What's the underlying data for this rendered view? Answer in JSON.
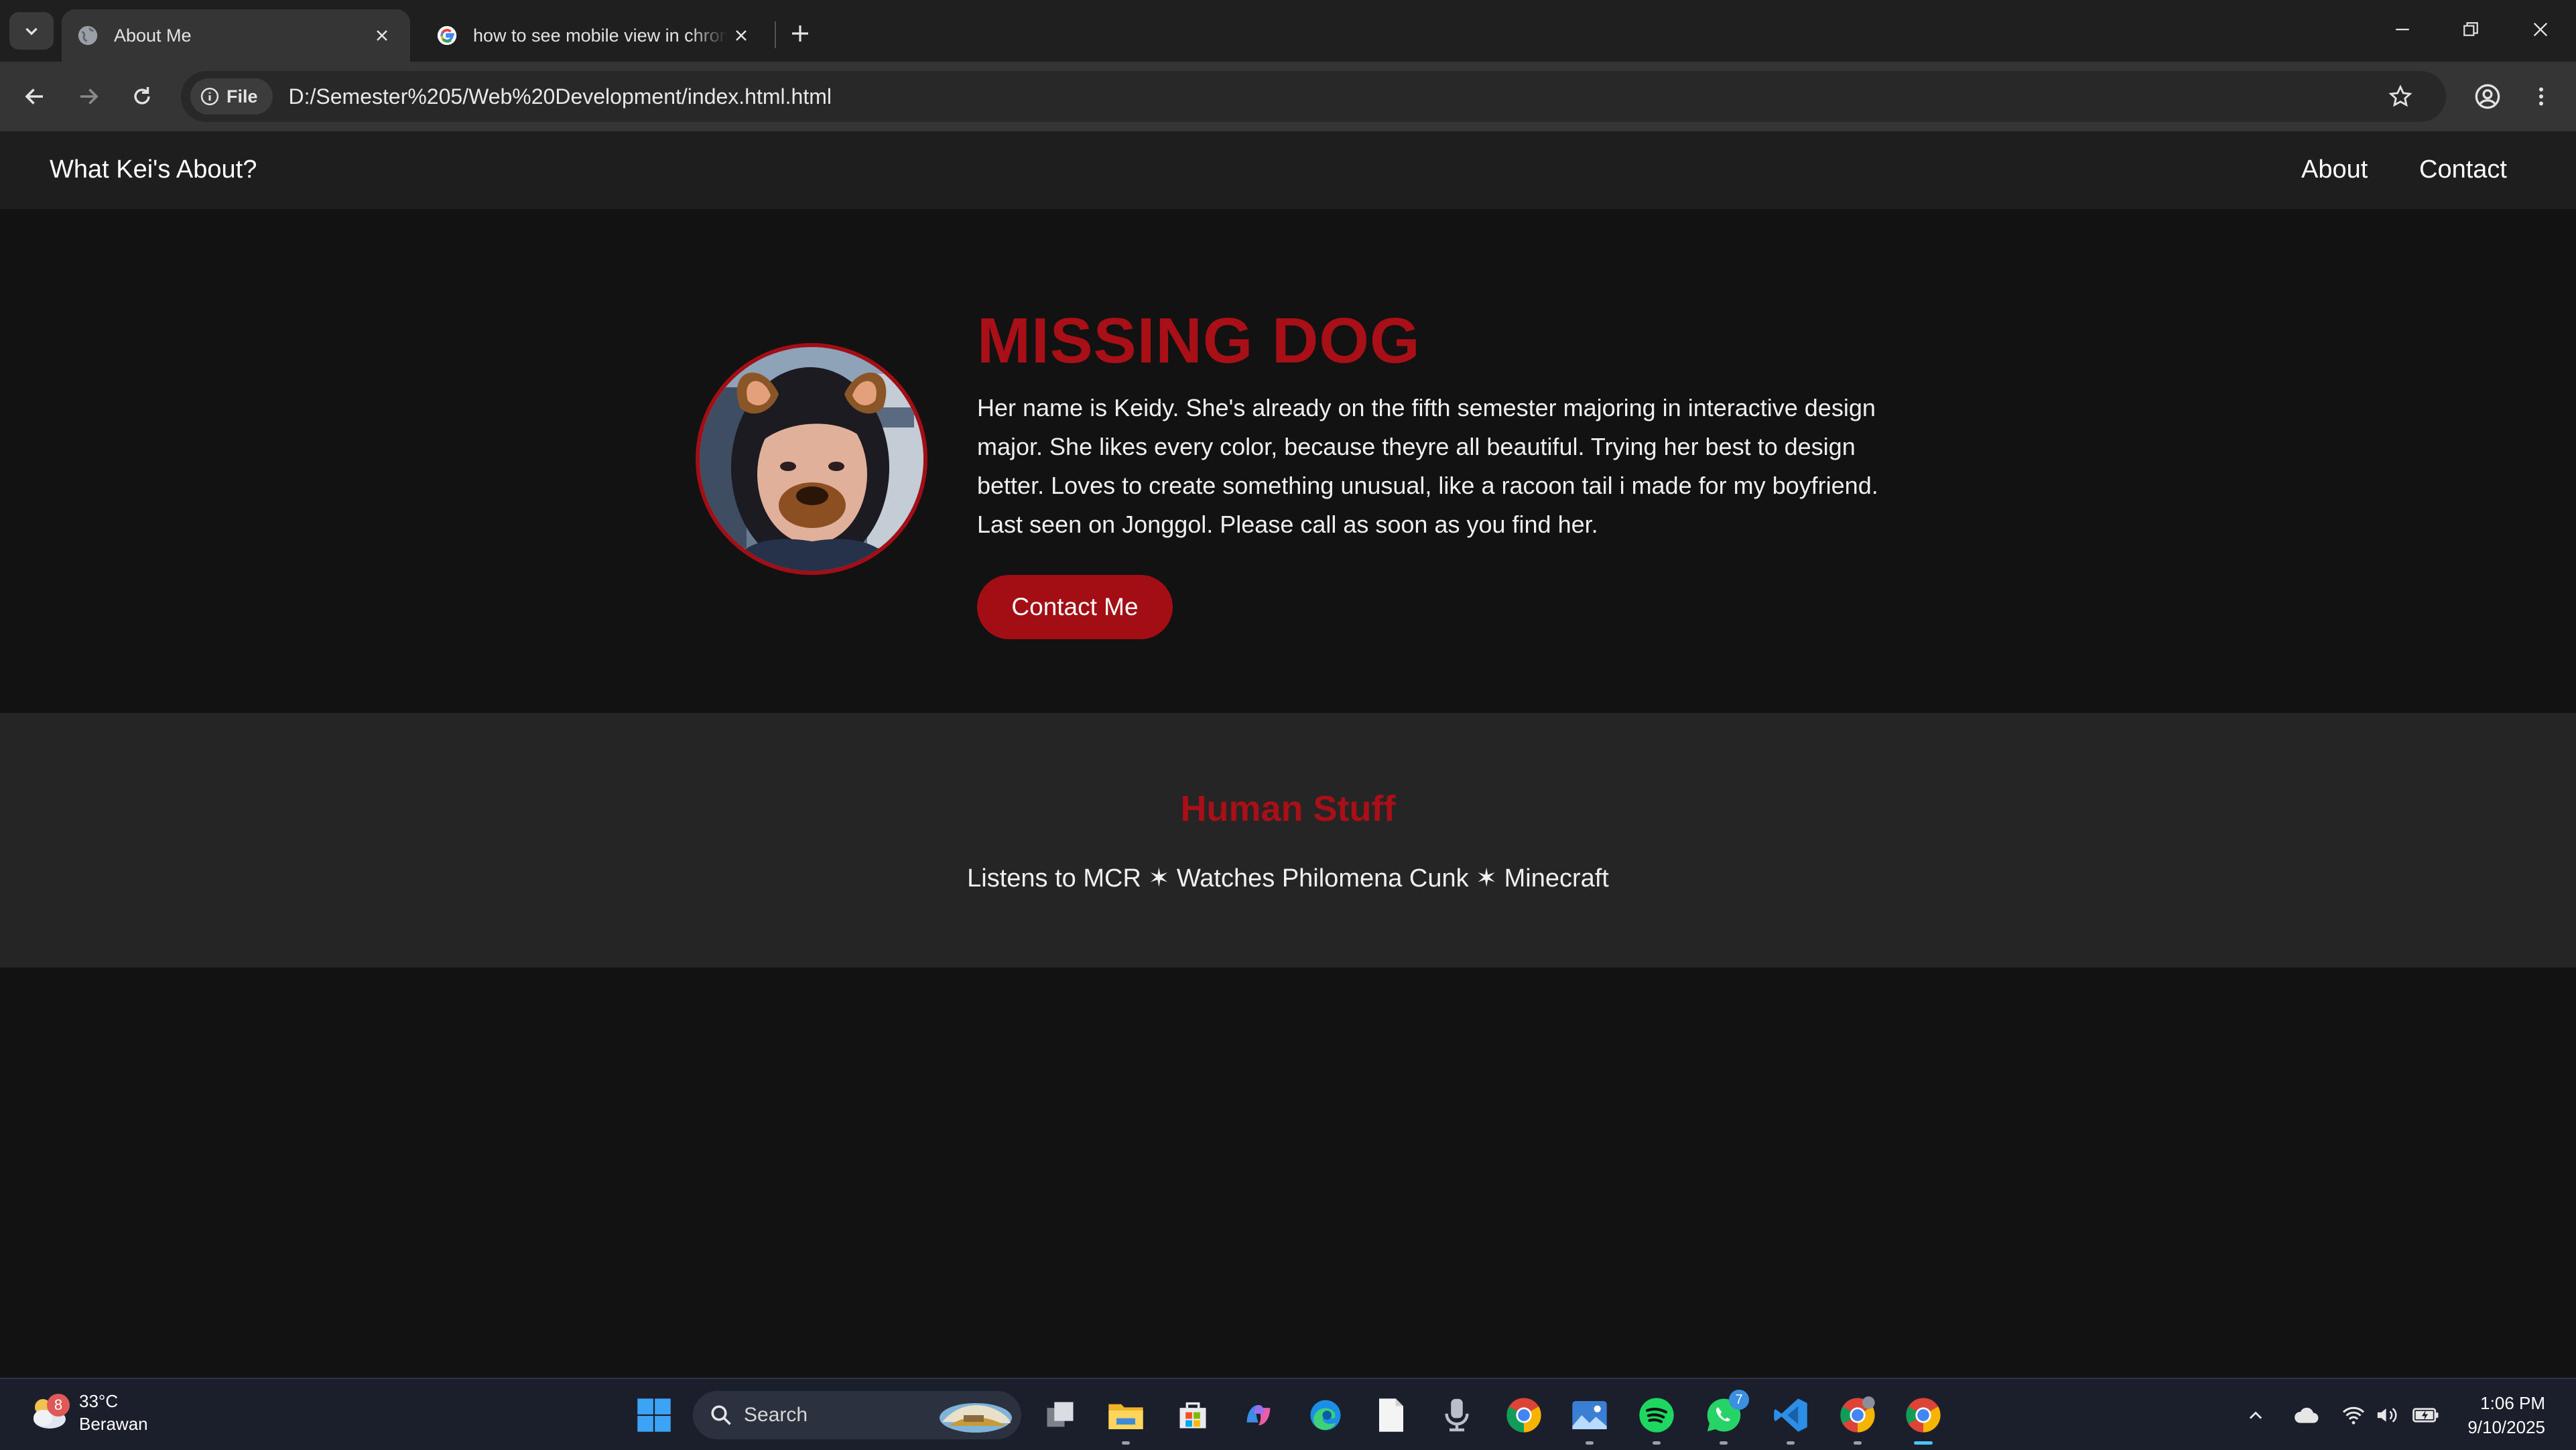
{
  "browser": {
    "tabs": [
      {
        "title": "About Me",
        "active": true
      },
      {
        "title": "how to see mobile view in chrome",
        "active": false
      }
    ],
    "address": {
      "chip_label": "File",
      "url": "D:/Semester%205/Web%20Development/index.html.html"
    }
  },
  "site": {
    "brand": "What Kei's About?",
    "nav": [
      {
        "label": "About"
      },
      {
        "label": "Contact"
      }
    ],
    "hero": {
      "title": "MISSING DOG",
      "text": "Her name is Keidy. She's already on the fifth semester majoring in interactive design major. She likes every color, because theyre all beautiful. Trying her best to design better. Loves to create something unusual, like a racoon tail i made for my boyfriend. Last seen on Jonggol. Please call as soon as you find her.",
      "button": "Contact Me"
    },
    "human": {
      "title": "Human Stuff",
      "list": "Listens to MCR ✶ Watches Philomena Cunk ✶ Minecraft"
    }
  },
  "taskbar": {
    "weather": {
      "temp": "33°C",
      "condition": "Berawan",
      "badge": "8"
    },
    "search_label": "Search",
    "whatsapp_badge": "7",
    "clock": {
      "time": "1:06 PM",
      "date": "9/10/2025"
    }
  },
  "colors": {
    "accent_red": "#a30e15",
    "page_bg": "#121212",
    "section_bg": "#252525",
    "nav_bg": "#1e1e1e"
  }
}
